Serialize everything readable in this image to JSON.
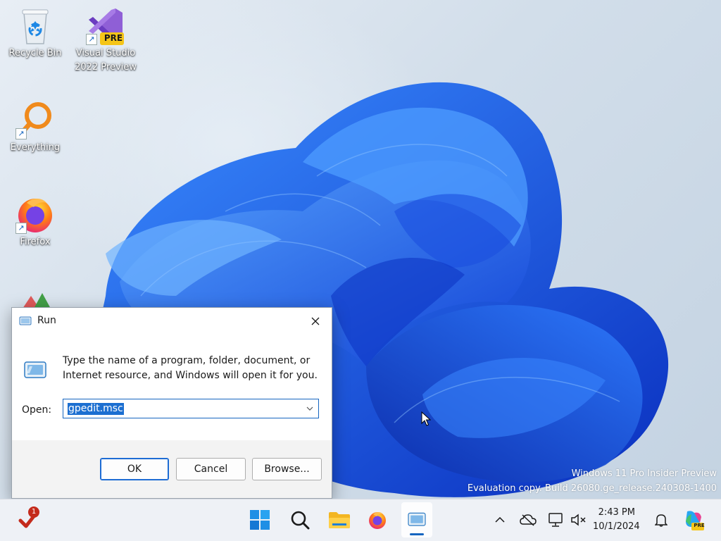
{
  "desktop_icons": [
    {
      "label": "Recycle Bin",
      "icon": "recycle-bin-icon"
    },
    {
      "label": "Visual Studio\n2022 Preview",
      "icon": "visual-studio-icon",
      "badge": "PRE"
    },
    {
      "label": "Everything",
      "icon": "everything-search-icon"
    },
    {
      "label": "Firefox",
      "icon": "firefox-icon"
    }
  ],
  "watermark": {
    "line1": "Windows 11 Pro Insider Preview",
    "line2": "Evaluation copy. Build 26080.ge_release.240308-1400"
  },
  "run_dialog": {
    "title": "Run",
    "description": "Type the name of a program, folder, document, or Internet resource, and Windows will open it for you.",
    "open_label": "Open:",
    "open_value": "gpedit.msc",
    "ok_label": "OK",
    "cancel_label": "Cancel",
    "browse_label": "Browse..."
  },
  "taskbar": {
    "notification_count": "1",
    "pinned": [
      "start-icon",
      "search-icon",
      "file-explorer-icon",
      "firefox-icon",
      "run-icon"
    ],
    "active": "run-icon",
    "tray": [
      "chevron-up-icon",
      "onedrive-icon",
      "network-icon",
      "volume-muted-icon"
    ],
    "clock": {
      "time": "2:43 PM",
      "date": "10/1/2024"
    },
    "copilot_badge": "PRE"
  },
  "colors": {
    "accent": "#1565c0",
    "selection": "#1c6fd1",
    "notification_badge": "#c42b1c"
  }
}
